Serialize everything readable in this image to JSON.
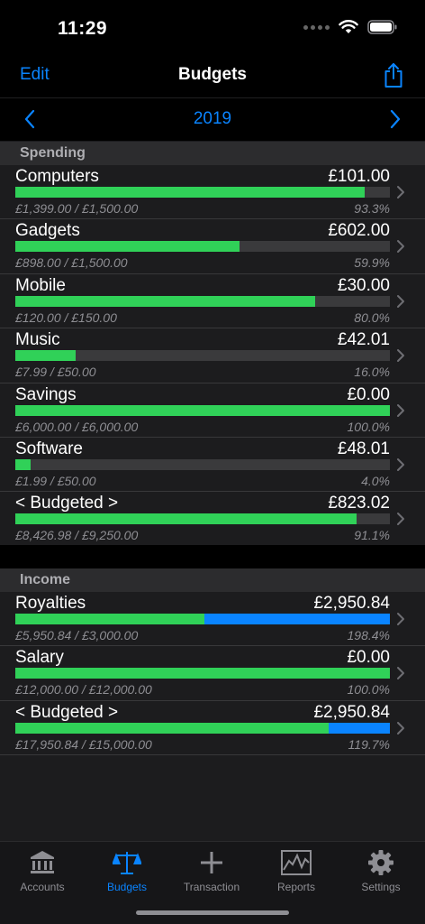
{
  "status": {
    "time": "11:29"
  },
  "nav": {
    "edit_label": "Edit",
    "title": "Budgets"
  },
  "year": {
    "label": "2019"
  },
  "spending": {
    "header": "Spending",
    "rows": [
      {
        "name": "Computers",
        "amount": "£101.00",
        "range": "£1,399.00 / £1,500.00",
        "percent": "93.3%",
        "fill": 0.933
      },
      {
        "name": "Gadgets",
        "amount": "£602.00",
        "range": "£898.00 / £1,500.00",
        "percent": "59.9%",
        "fill": 0.599
      },
      {
        "name": "Mobile",
        "amount": "£30.00",
        "range": "£120.00 / £150.00",
        "percent": "80.0%",
        "fill": 0.8
      },
      {
        "name": "Music",
        "amount": "£42.01",
        "range": "£7.99 / £50.00",
        "percent": "16.0%",
        "fill": 0.16
      },
      {
        "name": "Savings",
        "amount": "£0.00",
        "range": "£6,000.00 / £6,000.00",
        "percent": "100.0%",
        "fill": 1.0
      },
      {
        "name": "Software",
        "amount": "£48.01",
        "range": "£1.99 / £50.00",
        "percent": "4.0%",
        "fill": 0.04
      },
      {
        "name": "< Budgeted >",
        "amount": "£823.02",
        "range": "£8,426.98 / £9,250.00",
        "percent": "91.1%",
        "fill": 0.911
      }
    ]
  },
  "income": {
    "header": "Income",
    "rows": [
      {
        "name": "Royalties",
        "amount": "£2,950.84",
        "range": "£5,950.84 / £3,000.00",
        "percent": "198.4%",
        "fill": 0.504,
        "over": 0.496
      },
      {
        "name": "Salary",
        "amount": "£0.00",
        "range": "£12,000.00 / £12,000.00",
        "percent": "100.0%",
        "fill": 1.0
      },
      {
        "name": "< Budgeted >",
        "amount": "£2,950.84",
        "range": "£17,950.84 / £15,000.00",
        "percent": "119.7%",
        "fill": 0.836,
        "over": 0.164
      }
    ]
  },
  "tabs": [
    {
      "label": "Accounts",
      "icon": "bank-icon",
      "active": false
    },
    {
      "label": "Budgets",
      "icon": "scales-icon",
      "active": true
    },
    {
      "label": "Transaction",
      "icon": "plus-icon",
      "active": false
    },
    {
      "label": "Reports",
      "icon": "chart-icon",
      "active": false
    },
    {
      "label": "Settings",
      "icon": "gear-icon",
      "active": false
    }
  ],
  "colors": {
    "accent": "#0a84ff",
    "progress": "#30d158",
    "over_budget": "#0a84ff"
  }
}
